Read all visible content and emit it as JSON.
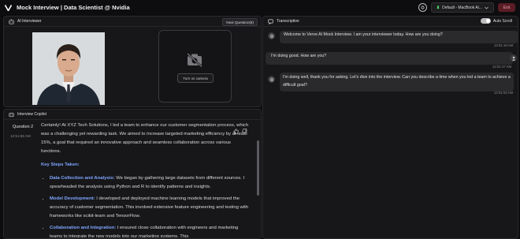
{
  "header": {
    "title": "Mock Interview | Data Scientist @ Nvidia",
    "mic_label": "Default - MacBook Ai...",
    "exit_label": "Exit"
  },
  "ai_panel": {
    "title": "AI Interviewer",
    "next_label": "Next Question(8)",
    "camera_label": "Turn on camera"
  },
  "copilot": {
    "title": "Interview Copilot",
    "question_label": "Question 2",
    "question_time": "12:51:55 AM",
    "intro": "Certainly! At XYZ Tech Solutions, I led a team to enhance our customer segmentation process, which was a challenging yet rewarding task. We aimed to increase targeted marketing efficiency by at least 15%, a goal that required an innovative approach and seamless collaboration across various functions.",
    "steps_title": "Key Steps Taken:",
    "steps": [
      {
        "title": "Data Collection and Analysis:",
        "text": " We began by gathering large datasets from different sources. I spearheaded the analysis using Python and R to identify patterns and insights."
      },
      {
        "title": "Model Development:",
        "text": " I developed and deployed machine learning models that improved the accuracy of customer segmentation. This involved extensive feature engineering and testing with frameworks like scikit-learn and TensorFlow."
      },
      {
        "title": "Collaboration and Integration:",
        "text": " I ensured close collaboration with engineers and marketing teams to integrate the new models into our marketing systems. This"
      }
    ]
  },
  "transcription": {
    "title": "Transcription",
    "autoscroll_label": "Auto Scroll",
    "messages": [
      {
        "text": "Welcome to Verve AI Mock Interview. I am your interviewer today. How are you doing?",
        "time": "12:51:18 AM"
      },
      {
        "text": "I'm doing good. How are you?",
        "time": "12:51:47 AM"
      },
      {
        "text": "I'm doing well, thank you for asking. Let's dive into the interview. Can you describe a time when you led a team to achieve a difficult goal?",
        "time": "12:51:53 AM"
      }
    ]
  }
}
